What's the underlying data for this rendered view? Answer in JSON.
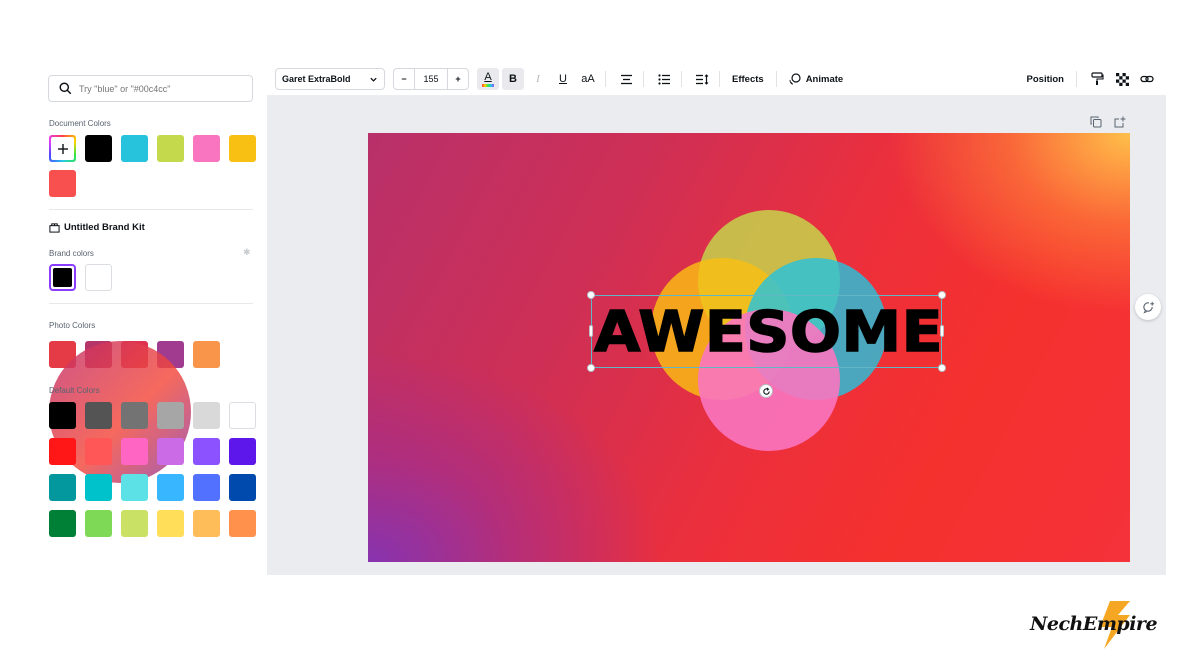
{
  "search": {
    "placeholder": "Try \"blue\" or \"#00c4cc\""
  },
  "document_colors": {
    "label": "Document Colors",
    "swatches": [
      "#000000",
      "#27c2dc",
      "#c4da4c",
      "#f975c0",
      "#f9c014",
      "#f7504f"
    ]
  },
  "brand_kit": {
    "title": "Untitled Brand Kit",
    "brand_colors_label": "Brand colors",
    "swatches": [
      "#000000",
      "#ffffff"
    ]
  },
  "photo_colors": {
    "label": "Photo Colors",
    "swatches": [
      "#e53b47",
      "#b53568",
      "#de324e",
      "#a13b8f",
      "#f9954a"
    ]
  },
  "default_colors": {
    "label": "Default Colors",
    "rows": [
      [
        "#000000",
        "#545454",
        "#737373",
        "#a6a6a6",
        "#d9d9d9",
        "#ffffff"
      ],
      [
        "#ff1616",
        "#ff5757",
        "#ff66c4",
        "#cb6ce6",
        "#8c52ff",
        "#5e17eb"
      ],
      [
        "#03989e",
        "#00c2cb",
        "#5ce1e6",
        "#38b6ff",
        "#5271ff",
        "#004aad"
      ],
      [
        "#008037",
        "#7ed957",
        "#c9e265",
        "#ffde59",
        "#ffbd59",
        "#ff914d"
      ]
    ]
  },
  "toolbar": {
    "font_name": "Garet ExtraBold",
    "minus": "−",
    "font_size": "155",
    "plus": "+",
    "text_color_glyph": "A",
    "bold": "B",
    "italic": "I",
    "underline": "U",
    "case": "aA",
    "effects": "Effects",
    "animate": "Animate",
    "position": "Position"
  },
  "canvas": {
    "text": "AWESOME",
    "circle_colors": [
      "#c4da4c",
      "#f9c014",
      "#27c2dc",
      "#f975c0"
    ]
  },
  "watermark": {
    "text": "NechEmpire"
  }
}
